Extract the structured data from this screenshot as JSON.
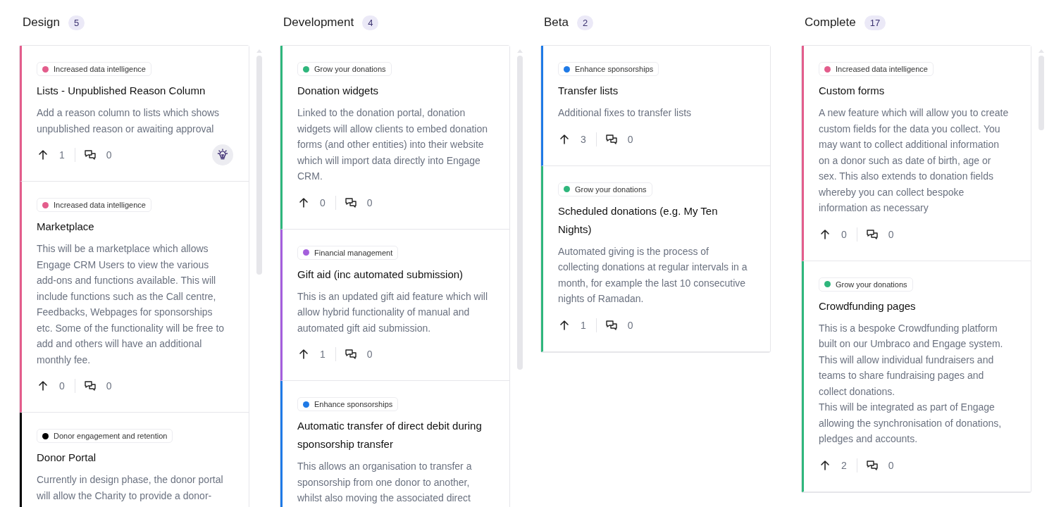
{
  "columns": [
    {
      "title": "Design",
      "count": "5",
      "scrollbar": true,
      "cards": [
        {
          "tag": "Increased data intelligence",
          "color": "#e35d8c",
          "title": "Lists - Unpublished Reason Column",
          "description": "Add a reason column to lists which shows unpublished reason or awaiting approval",
          "upvotes": "1",
          "comments": "0",
          "idea": true
        },
        {
          "tag": "Increased data intelligence",
          "color": "#e35d8c",
          "title": "Marketplace",
          "description": "This will be a marketplace which allows Engage CRM Users to view the various add-ons and functions available. This will include functions such as the Call centre, Feedbacks, Webpages for sponsorships etc. Some of the functionality will be free to add and others will have an additional monthly fee.",
          "upvotes": "0",
          "comments": "0",
          "idea": false
        },
        {
          "tag": "Donor engagement and retention",
          "color": "#000000",
          "title": "Donor Portal",
          "description": "Currently in design phase, the donor portal will allow the Charity to provide a donor-"
        }
      ]
    },
    {
      "title": "Development",
      "count": "4",
      "scrollbar": true,
      "cards": [
        {
          "tag": "Grow your donations",
          "color": "#2fb67c",
          "title": "Donation widgets",
          "description": "Linked to the donation portal, donation widgets will allow clients to embed donation forms (and other entities) into their website which will import data directly into Engage CRM.",
          "upvotes": "0",
          "comments": "0",
          "idea": false
        },
        {
          "tag": "Financial management",
          "color": "#a45fdc",
          "title": "Gift aid (inc automated submission)",
          "description": "This is an updated gift aid feature which will allow hybrid functionality of manual and automated gift aid submission.",
          "upvotes": "1",
          "comments": "0",
          "idea": false
        },
        {
          "tag": "Enhance sponsorships",
          "color": "#1f7ae6",
          "title": "Automatic transfer of direct debit during sponsorship transfer",
          "description": "This allows an organisation to transfer a sponsorship from one donor to another, whilst also moving the associated direct"
        }
      ]
    },
    {
      "title": "Beta",
      "count": "2",
      "scrollbar": false,
      "cards": [
        {
          "tag": "Enhance sponsorships",
          "color": "#1f7ae6",
          "title": "Transfer lists",
          "description": "Additional fixes to transfer lists",
          "upvotes": "3",
          "comments": "0",
          "idea": false
        },
        {
          "tag": "Grow your donations",
          "color": "#2fb67c",
          "title": "Scheduled donations (e.g. My Ten Nights)",
          "description": "Automated giving is the process of collecting donations at regular intervals in a month, for example the last 10 consecutive nights of Ramadan.",
          "upvotes": "1",
          "comments": "0",
          "idea": false
        }
      ]
    },
    {
      "title": "Complete",
      "count": "17",
      "scrollbar": true,
      "cards": [
        {
          "tag": "Increased data intelligence",
          "color": "#e35d8c",
          "title": "Custom forms",
          "description": "A new feature which will allow you to create custom fields for the data you collect. You may want to collect additional information on a donor such as date of birth, age or sex. This also extends to donation fields whereby you can collect bespoke information as necessary",
          "upvotes": "0",
          "comments": "0",
          "idea": false
        },
        {
          "tag": "Grow your donations",
          "color": "#2fb67c",
          "title": "Crowdfunding pages",
          "description": "This is a bespoke Crowdfunding platform built on our Umbraco and Engage system. This will allow individual fundraisers and teams to share fundraising pages and collect donations.\nThis will be integrated as part of Engage allowing the synchronisation of donations, pledges and accounts.",
          "upvotes": "2",
          "comments": "0",
          "idea": false
        }
      ]
    }
  ]
}
